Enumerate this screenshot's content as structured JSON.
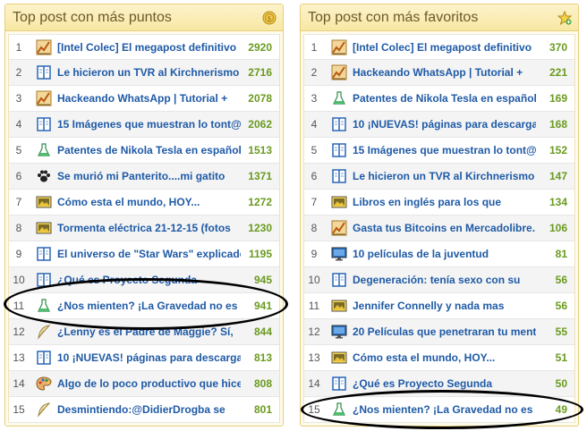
{
  "left": {
    "title": "Top post con más puntos",
    "header_icon": "coin-icon",
    "items": [
      {
        "rank": "1",
        "icon": "chart-icon",
        "title": "[Intel Colec] El megapost definitivo",
        "value": "2920"
      },
      {
        "rank": "2",
        "icon": "book-icon",
        "title": "Le hicieron un TVR al Kirchnerismo y",
        "value": "2716"
      },
      {
        "rank": "3",
        "icon": "chart-icon",
        "title": "Hackeando WhatsApp | Tutorial +",
        "value": "2078"
      },
      {
        "rank": "4",
        "icon": "book-icon",
        "title": "15 Imágenes que muestran lo tont@",
        "value": "2062"
      },
      {
        "rank": "5",
        "icon": "flask-icon",
        "title": "Patentes de Nikola Tesla en español,",
        "value": "1513"
      },
      {
        "rank": "6",
        "icon": "paw-icon",
        "title": "Se murió mi Panterito....mi gatito",
        "value": "1371"
      },
      {
        "rank": "7",
        "icon": "image-icon",
        "title": "Cómo esta el mundo, HOY...",
        "value": "1272"
      },
      {
        "rank": "8",
        "icon": "image-icon",
        "title": "Tormenta eléctrica 21-12-15 (fotos",
        "value": "1230"
      },
      {
        "rank": "9",
        "icon": "book-icon",
        "title": "El universo de \"Star Wars\" explicado",
        "value": "1195"
      },
      {
        "rank": "10",
        "icon": "book-icon",
        "title": "¿Qué es Proyecto Segunda",
        "value": "945"
      },
      {
        "rank": "11",
        "icon": "flask-icon",
        "title": "¿Nos mienten? ¡La Gravedad no es",
        "value": "941"
      },
      {
        "rank": "12",
        "icon": "quill-icon",
        "title": "¿Lenny es el Padre de Maggie? Sí,",
        "value": "844"
      },
      {
        "rank": "13",
        "icon": "book-icon",
        "title": "10 ¡NUEVAS! páginas para descargar",
        "value": "813"
      },
      {
        "rank": "14",
        "icon": "palette-icon",
        "title": "Algo de lo poco productivo que hice",
        "value": "808"
      },
      {
        "rank": "15",
        "icon": "quill-icon",
        "title": "Desmintiendo:@DidierDrogba se",
        "value": "801"
      }
    ]
  },
  "right": {
    "title": "Top post con más favoritos",
    "header_icon": "star-add-icon",
    "items": [
      {
        "rank": "1",
        "icon": "chart-icon",
        "title": "[Intel Colec] El megapost definitivo",
        "value": "370"
      },
      {
        "rank": "2",
        "icon": "chart-icon",
        "title": "Hackeando WhatsApp | Tutorial +",
        "value": "221"
      },
      {
        "rank": "3",
        "icon": "flask-icon",
        "title": "Patentes de Nikola Tesla en español,",
        "value": "169"
      },
      {
        "rank": "4",
        "icon": "book-icon",
        "title": "10 ¡NUEVAS! páginas para descargar",
        "value": "168"
      },
      {
        "rank": "5",
        "icon": "book-icon",
        "title": "15 Imágenes que muestran lo tont@",
        "value": "152"
      },
      {
        "rank": "6",
        "icon": "book-icon",
        "title": "Le hicieron un TVR al Kirchnerismo y",
        "value": "147"
      },
      {
        "rank": "7",
        "icon": "image-icon",
        "title": "Libros en inglés para los que",
        "value": "134"
      },
      {
        "rank": "8",
        "icon": "chart-icon",
        "title": "Gasta tus Bitcoins en Mercadolibre.",
        "value": "106"
      },
      {
        "rank": "9",
        "icon": "monitor-icon",
        "title": "10 películas de la juventud",
        "value": "81"
      },
      {
        "rank": "10",
        "icon": "book-icon",
        "title": "Degeneración: tenía sexo con su",
        "value": "56"
      },
      {
        "rank": "11",
        "icon": "image-icon",
        "title": "Jennifer Connelly y nada mas",
        "value": "56"
      },
      {
        "rank": "12",
        "icon": "monitor-icon",
        "title": "20 Películas que penetraran tu mente",
        "value": "55"
      },
      {
        "rank": "13",
        "icon": "image-icon",
        "title": "Cómo esta el mundo, HOY...",
        "value": "51"
      },
      {
        "rank": "14",
        "icon": "book-icon",
        "title": "¿Qué es Proyecto Segunda",
        "value": "50"
      },
      {
        "rank": "15",
        "icon": "flask-icon",
        "title": "¿Nos mienten? ¡La Gravedad no es",
        "value": "49"
      }
    ]
  },
  "colors": {
    "title_link": "#1f5aa6",
    "points": "#6a9a1f",
    "panel_border": "#e7cf7a",
    "annotation": "#000000"
  }
}
